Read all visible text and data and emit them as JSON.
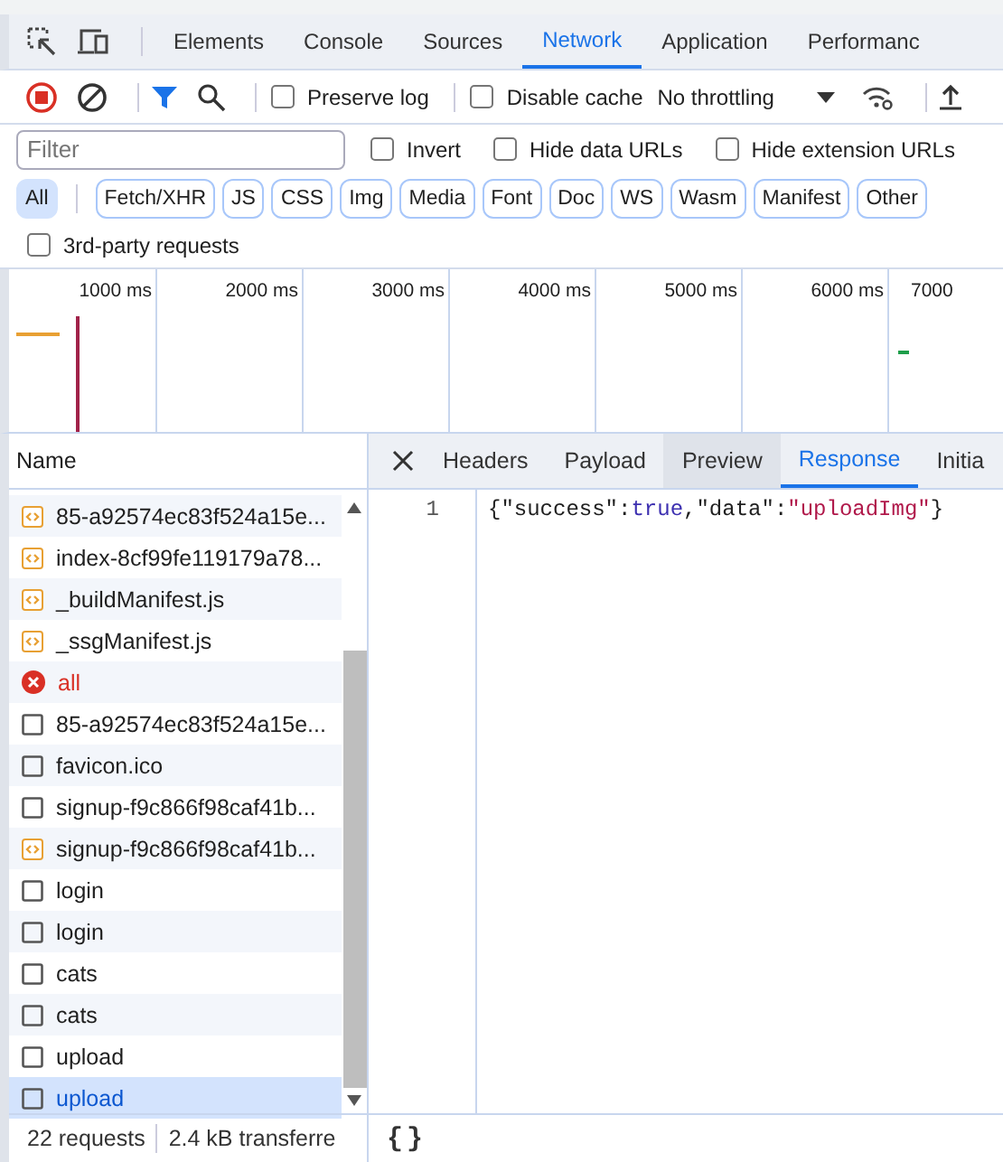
{
  "main_tabs": [
    {
      "label": "Elements",
      "selected": false
    },
    {
      "label": "Console",
      "selected": false
    },
    {
      "label": "Sources",
      "selected": false
    },
    {
      "label": "Network",
      "selected": true
    },
    {
      "label": "Application",
      "selected": false
    },
    {
      "label": "Performanc",
      "selected": false
    }
  ],
  "toolbar": {
    "recording": true,
    "filter_active": true,
    "preserve_log": {
      "label": "Preserve log",
      "checked": false
    },
    "disable_cache": {
      "label": "Disable cache",
      "checked": false
    },
    "throttling": "No throttling"
  },
  "filter": {
    "placeholder": "Filter",
    "options": [
      {
        "label": "Invert",
        "checked": false
      },
      {
        "label": "Hide data URLs",
        "checked": false
      },
      {
        "label": "Hide extension URLs",
        "checked": false
      }
    ]
  },
  "type_chips": [
    {
      "label": "All",
      "selected": true
    },
    {
      "label": "Fetch/XHR",
      "selected": false
    },
    {
      "label": "JS",
      "selected": false
    },
    {
      "label": "CSS",
      "selected": false
    },
    {
      "label": "Img",
      "selected": false
    },
    {
      "label": "Media",
      "selected": false
    },
    {
      "label": "Font",
      "selected": false
    },
    {
      "label": "Doc",
      "selected": false
    },
    {
      "label": "WS",
      "selected": false
    },
    {
      "label": "Wasm",
      "selected": false
    },
    {
      "label": "Manifest",
      "selected": false
    },
    {
      "label": "Other",
      "selected": false
    }
  ],
  "third_party": {
    "label": "3rd-party requests",
    "checked": false
  },
  "overview_ticks": [
    "1000 ms",
    "2000 ms",
    "3000 ms",
    "4000 ms",
    "5000 ms",
    "6000 ms",
    "7000"
  ],
  "requests": {
    "column": "Name",
    "rows": [
      {
        "name": "85-a92574ec83f524a15e...",
        "kind": "script",
        "selected": false
      },
      {
        "name": "index-8cf99fe119179a78...",
        "kind": "script",
        "selected": false
      },
      {
        "name": "_buildManifest.js",
        "kind": "script",
        "selected": false
      },
      {
        "name": "_ssgManifest.js",
        "kind": "script",
        "selected": false
      },
      {
        "name": "all",
        "kind": "error",
        "selected": false
      },
      {
        "name": "85-a92574ec83f524a15e...",
        "kind": "doc",
        "selected": false
      },
      {
        "name": "favicon.ico",
        "kind": "doc",
        "selected": false
      },
      {
        "name": "signup-f9c866f98caf41b...",
        "kind": "doc",
        "selected": false
      },
      {
        "name": "signup-f9c866f98caf41b...",
        "kind": "script",
        "selected": false
      },
      {
        "name": "login",
        "kind": "doc",
        "selected": false
      },
      {
        "name": "login",
        "kind": "doc",
        "selected": false
      },
      {
        "name": "cats",
        "kind": "doc",
        "selected": false
      },
      {
        "name": "cats",
        "kind": "doc",
        "selected": false
      },
      {
        "name": "upload",
        "kind": "doc",
        "selected": false
      },
      {
        "name": "upload",
        "kind": "doc",
        "selected": true
      }
    ]
  },
  "detail_tabs": [
    {
      "label": "Headers",
      "selected": false,
      "hovered": false
    },
    {
      "label": "Payload",
      "selected": false,
      "hovered": false
    },
    {
      "label": "Preview",
      "selected": false,
      "hovered": true
    },
    {
      "label": "Response",
      "selected": true,
      "hovered": false
    },
    {
      "label": "Initia",
      "selected": false,
      "hovered": false
    }
  ],
  "response": {
    "lines": [
      {
        "number": "1",
        "tokens": [
          {
            "text": "{\"success\":",
            "kind": "plain"
          },
          {
            "text": "true",
            "kind": "atom"
          },
          {
            "text": ",\"data\":",
            "kind": "plain"
          },
          {
            "text": "\"uploadImg\"",
            "kind": "string"
          },
          {
            "text": "}",
            "kind": "plain"
          }
        ]
      }
    ]
  },
  "status": {
    "requests": "22 requests",
    "transferred": "2.4 kB transferre",
    "format_button": "{}"
  }
}
